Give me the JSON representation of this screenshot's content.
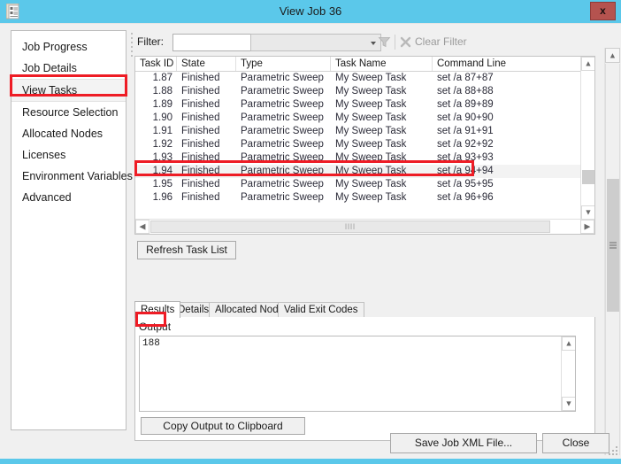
{
  "window": {
    "title": "View Job 36",
    "icon": "document-list-icon",
    "close_label": "x",
    "accent_color": "#5bc8ea",
    "close_button_color": "#b5534f",
    "annotation_color": "#ee1c25",
    "client_bg": "#f0f0f0"
  },
  "sidebar": {
    "items": [
      {
        "label": "Job Progress",
        "selected": false
      },
      {
        "label": "Job Details",
        "selected": false
      },
      {
        "label": "View Tasks",
        "selected": true
      },
      {
        "label": "Resource Selection",
        "selected": false
      },
      {
        "label": "Allocated Nodes",
        "selected": false
      },
      {
        "label": "Licenses",
        "selected": false
      },
      {
        "label": "Environment Variables",
        "selected": false
      },
      {
        "label": "Advanced",
        "selected": false
      }
    ]
  },
  "filter_bar": {
    "label": "Filter:",
    "field_value": "",
    "field_placeholder": "",
    "value_value": "",
    "value_placeholder": "",
    "funnel_icon": "funnel-icon",
    "clear_icon": "clear-x-icon",
    "clear_label": "Clear Filter",
    "clear_enabled": false
  },
  "task_grid": {
    "columns": [
      "Task ID",
      "State",
      "Type",
      "Task Name",
      "Command Line"
    ],
    "rows": [
      {
        "id": "1.87",
        "state": "Finished",
        "type": "Parametric Sweep",
        "name": "My Sweep Task",
        "cmd": "set /a 87+87",
        "selected": false
      },
      {
        "id": "1.88",
        "state": "Finished",
        "type": "Parametric Sweep",
        "name": "My Sweep Task",
        "cmd": "set /a 88+88",
        "selected": false
      },
      {
        "id": "1.89",
        "state": "Finished",
        "type": "Parametric Sweep",
        "name": "My Sweep Task",
        "cmd": "set /a 89+89",
        "selected": false
      },
      {
        "id": "1.90",
        "state": "Finished",
        "type": "Parametric Sweep",
        "name": "My Sweep Task",
        "cmd": "set /a 90+90",
        "selected": false
      },
      {
        "id": "1.91",
        "state": "Finished",
        "type": "Parametric Sweep",
        "name": "My Sweep Task",
        "cmd": "set /a 91+91",
        "selected": false
      },
      {
        "id": "1.92",
        "state": "Finished",
        "type": "Parametric Sweep",
        "name": "My Sweep Task",
        "cmd": "set /a 92+92",
        "selected": false
      },
      {
        "id": "1.93",
        "state": "Finished",
        "type": "Parametric Sweep",
        "name": "My Sweep Task",
        "cmd": "set /a 93+93",
        "selected": false
      },
      {
        "id": "1.94",
        "state": "Finished",
        "type": "Parametric Sweep",
        "name": "My Sweep Task",
        "cmd": "set /a 94+94",
        "selected": true
      },
      {
        "id": "1.95",
        "state": "Finished",
        "type": "Parametric Sweep",
        "name": "My Sweep Task",
        "cmd": "set /a 95+95",
        "selected": false
      },
      {
        "id": "1.96",
        "state": "Finished",
        "type": "Parametric Sweep",
        "name": "My Sweep Task",
        "cmd": "set /a 96+96",
        "selected": false
      }
    ],
    "hthumb_glyph": "llll"
  },
  "refresh_button": {
    "label": "Refresh Task List"
  },
  "tabs": [
    {
      "label": "Results",
      "active": true
    },
    {
      "label": "Details",
      "active": false
    },
    {
      "label": "Allocated Nodes",
      "active": false
    },
    {
      "label": "Valid Exit Codes",
      "active": false
    }
  ],
  "results": {
    "output_label": "Output",
    "output_text": "188",
    "copy_button": "Copy Output to Clipboard"
  },
  "footer": {
    "save_button": "Save Job XML File...",
    "close_button": "Close"
  }
}
